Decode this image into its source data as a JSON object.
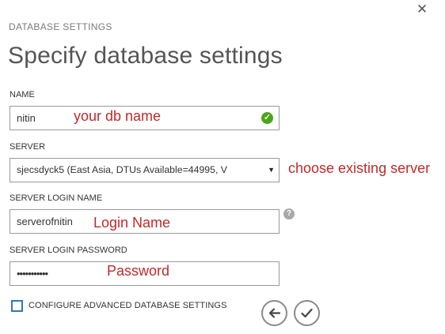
{
  "dialog": {
    "section_label": "DATABASE SETTINGS",
    "title": "Specify database settings",
    "close_icon": "close-icon"
  },
  "name_field": {
    "label": "NAME",
    "value": "nitin",
    "status_icon": "check-circle-icon",
    "status_color": "#4ba51a",
    "annotation": "your db name"
  },
  "server_field": {
    "label": "SERVER",
    "value": "sjecsdyck5 (East Asia, DTUs Available=44995, V",
    "annotation": "choose existing server"
  },
  "login_field": {
    "label": "SERVER LOGIN NAME",
    "value": "serverofnitin",
    "help_icon": "question-circle-icon",
    "annotation": "Login Name"
  },
  "password_field": {
    "label": "SERVER LOGIN PASSWORD",
    "value": "•••••••••••",
    "annotation": "Password"
  },
  "advanced": {
    "label": "CONFIGURE ADVANCED DATABASE SETTINGS",
    "checked": false
  },
  "nav": {
    "back_icon": "arrow-left-icon",
    "confirm_icon": "checkmark-icon"
  },
  "colors": {
    "annotation": "#c62828",
    "checkbox_border": "#2d7bbf"
  }
}
